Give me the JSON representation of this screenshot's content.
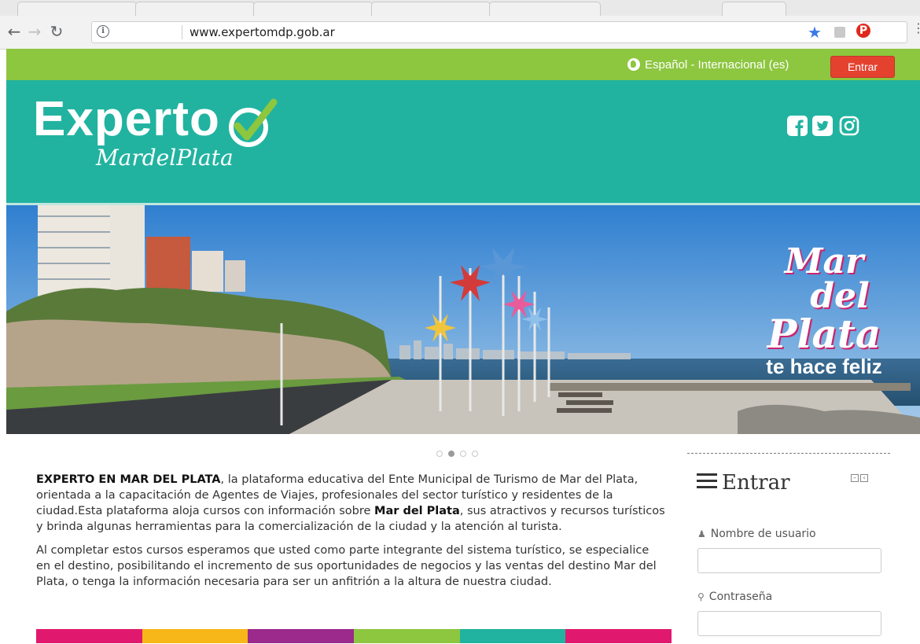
{
  "browser": {
    "url": "www.expertomdp.gob.ar"
  },
  "topbar": {
    "language": "Español - Internacional (es)",
    "login_button": "Entrar"
  },
  "header": {
    "logo_main": "Experto",
    "logo_sub": "MardelPlata"
  },
  "hero": {
    "slogan": [
      "Mar",
      "del",
      "Plata",
      "te hace feliz"
    ],
    "slides_total": 4,
    "active_slide": 2
  },
  "main": {
    "para1_bold": "EXPERTO EN MAR DEL PLATA",
    "para1_a": ", la plataforma educativa del Ente Municipal de Turismo de Mar del Plata, orientada a la capacitación de Agentes de Viajes, profesionales del sector turístico y residentes de la ciudad.Esta plataforma aloja cursos con información sobre ",
    "para1_bold2": "Mar del Plata",
    "para1_b": ", sus atractivos y recursos turísticos y brinda algunas herramientas para la comercialización de la ciudad y la atención al turista.",
    "para2": "Al completar estos cursos esperamos que usted como parte integrante del sistema turístico, se especialice en el destino, posibilitando el incremento de sus oportunidades de negocios y las ventas del destino Mar del Plata, o tenga la información necesaria para ser un anfitrión a la altura de nuestra ciudad."
  },
  "sidebar": {
    "title": "Entrar",
    "username_label": "Nombre de usuario",
    "password_label": "Contraseña",
    "username_value": "",
    "password_value": ""
  },
  "colors": {
    "topbar": "#8dc63f",
    "header": "#21b3a0",
    "login_button": "#e4412f",
    "colorbar": [
      "#e0196e",
      "#f7b718",
      "#9b2a8c",
      "#8dc63f",
      "#21b3a0",
      "#e0196e"
    ]
  },
  "icons": [
    "back-icon",
    "forward-icon",
    "reload-icon",
    "info-icon",
    "star-icon",
    "pdf-extension-icon",
    "pinterest-icon",
    "menu-icon",
    "globe-icon",
    "facebook-icon",
    "twitter-icon",
    "instagram-icon",
    "hamburger-icon",
    "user-icon",
    "key-icon"
  ]
}
